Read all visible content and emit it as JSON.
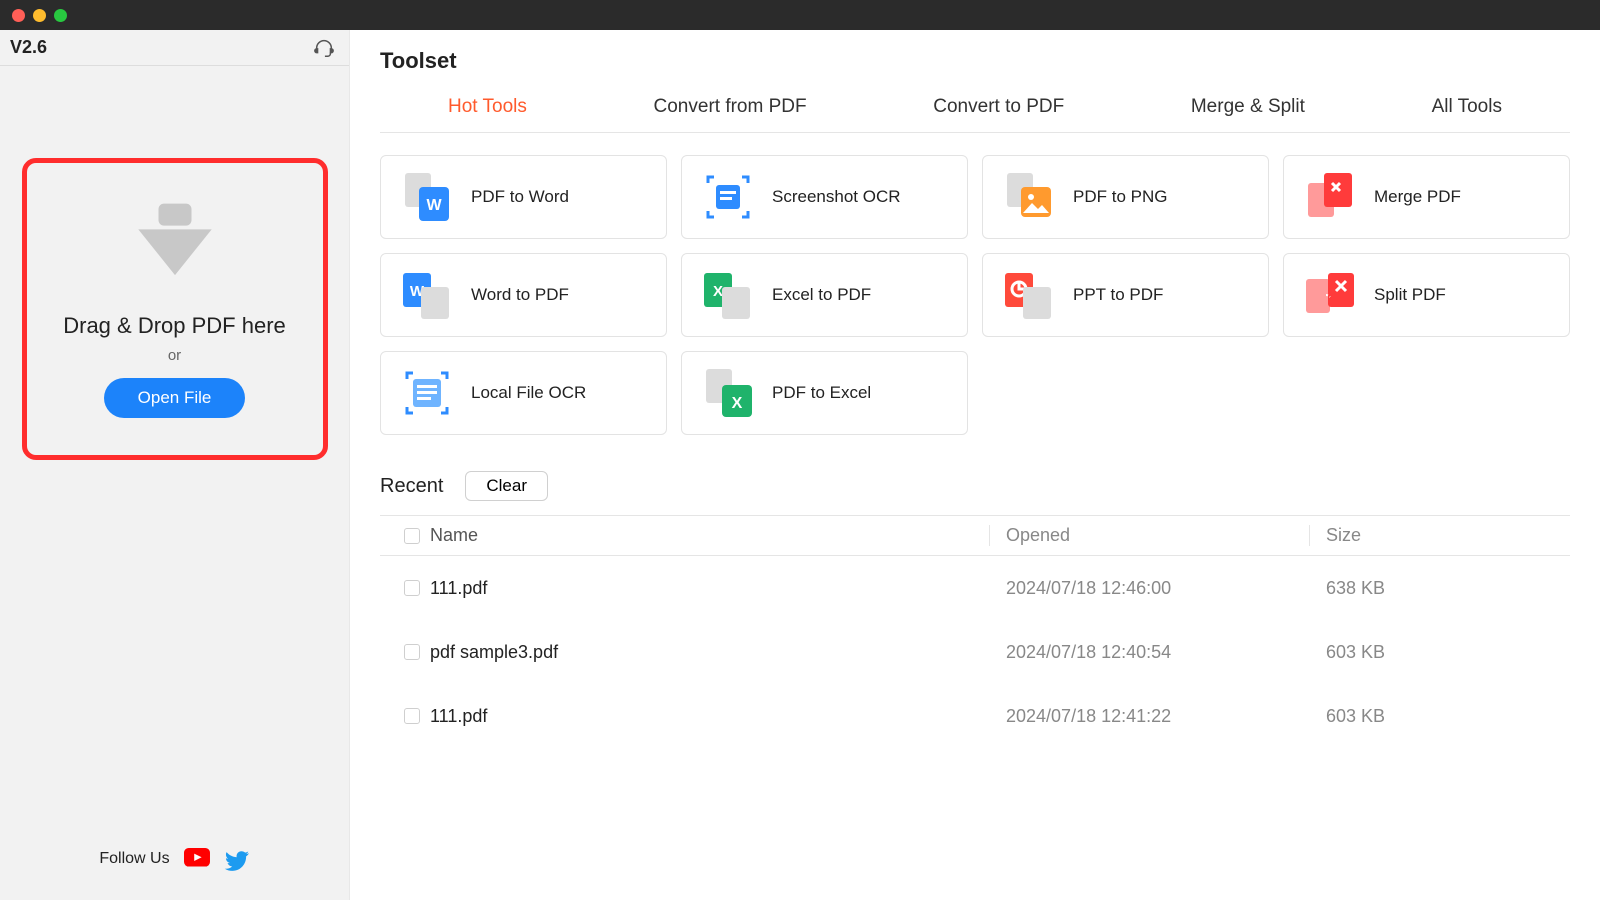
{
  "sidebar": {
    "version": "V2.6",
    "drop_title": "Drag & Drop PDF here",
    "drop_or": "or",
    "open_file": "Open File",
    "follow_us": "Follow Us"
  },
  "header": {
    "title": "Toolset"
  },
  "tabs": [
    {
      "label": "Hot Tools",
      "active": true
    },
    {
      "label": "Convert from PDF",
      "active": false
    },
    {
      "label": "Convert to PDF",
      "active": false
    },
    {
      "label": "Merge & Split",
      "active": false
    },
    {
      "label": "All Tools",
      "active": false
    }
  ],
  "tools": [
    {
      "label": "PDF to Word",
      "icon": "pdf-word"
    },
    {
      "label": "Screenshot OCR",
      "icon": "screenshot-ocr"
    },
    {
      "label": "PDF to PNG",
      "icon": "pdf-png"
    },
    {
      "label": "Merge PDF",
      "icon": "merge-pdf"
    },
    {
      "label": "Word to PDF",
      "icon": "word-pdf"
    },
    {
      "label": "Excel to PDF",
      "icon": "excel-pdf"
    },
    {
      "label": "PPT to PDF",
      "icon": "ppt-pdf"
    },
    {
      "label": "Split PDF",
      "icon": "split-pdf"
    },
    {
      "label": "Local File OCR",
      "icon": "local-ocr"
    },
    {
      "label": "PDF to Excel",
      "icon": "pdf-excel"
    }
  ],
  "recent": {
    "title": "Recent",
    "clear": "Clear",
    "columns": {
      "name": "Name",
      "opened": "Opened",
      "size": "Size"
    },
    "rows": [
      {
        "name": "111.pdf",
        "opened": "2024/07/18 12:46:00",
        "size": "638 KB"
      },
      {
        "name": "pdf sample3.pdf",
        "opened": "2024/07/18 12:40:54",
        "size": "603 KB"
      },
      {
        "name": "111.pdf",
        "opened": "2024/07/18 12:41:22",
        "size": "603 KB"
      }
    ]
  },
  "colors": {
    "accent_red": "#ff2d2d",
    "accent_blue": "#1c83fa",
    "tab_active": "#ff5a2c"
  }
}
